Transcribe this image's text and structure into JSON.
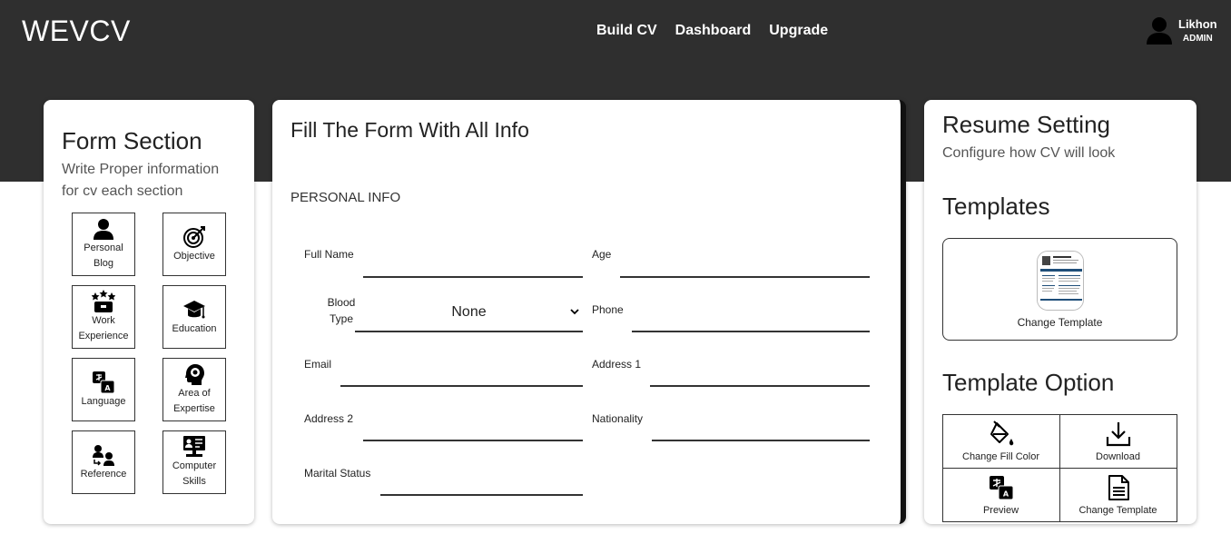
{
  "brand": "WEVCV",
  "nav": {
    "build": "Build CV",
    "dashboard": "Dashboard",
    "upgrade": "Upgrade"
  },
  "user": {
    "name": "Likhon",
    "role": "ADMIN"
  },
  "form_section": {
    "title": "Form Section",
    "subtitle": "Write Proper information for cv each section",
    "items": [
      {
        "label": "Personal Blog",
        "icon": "person-icon"
      },
      {
        "label": "Objective",
        "icon": "target-icon"
      },
      {
        "label": "Work Experience",
        "icon": "briefcase-icon"
      },
      {
        "label": "Education",
        "icon": "graduation-cap-icon"
      },
      {
        "label": "Language",
        "icon": "translate-icon"
      },
      {
        "label": "Area of Expertise",
        "icon": "head-gear-icon"
      },
      {
        "label": "Reference",
        "icon": "people-icon"
      },
      {
        "label": "Computer Skills",
        "icon": "computer-icon"
      }
    ]
  },
  "form": {
    "title": "Fill The Form With All Info",
    "section": "PERSONAL INFO",
    "labels": {
      "full_name": "Full Name",
      "age": "Age",
      "blood_type": "Blood Type",
      "phone": "Phone",
      "email": "Email",
      "address1": "Address 1",
      "address2": "Address 2",
      "nationality": "Nationality",
      "marital_status": "Marital Status"
    },
    "blood_type_value": "None"
  },
  "settings": {
    "title": "Resume Setting",
    "subtitle": "Configure how CV will look",
    "templates_title": "Templates",
    "change_template": "Change Template",
    "options_title": "Template Option",
    "options": [
      {
        "label": "Change Fill Color",
        "icon": "paint-bucket-icon"
      },
      {
        "label": "Download",
        "icon": "download-icon"
      },
      {
        "label": "Preview",
        "icon": "translate-icon"
      },
      {
        "label": "Change Template",
        "icon": "document-icon"
      }
    ]
  },
  "colors": {
    "header_bg": "#2f2f2f",
    "text": "#222222",
    "accent_thumb": "#1f4e79"
  }
}
